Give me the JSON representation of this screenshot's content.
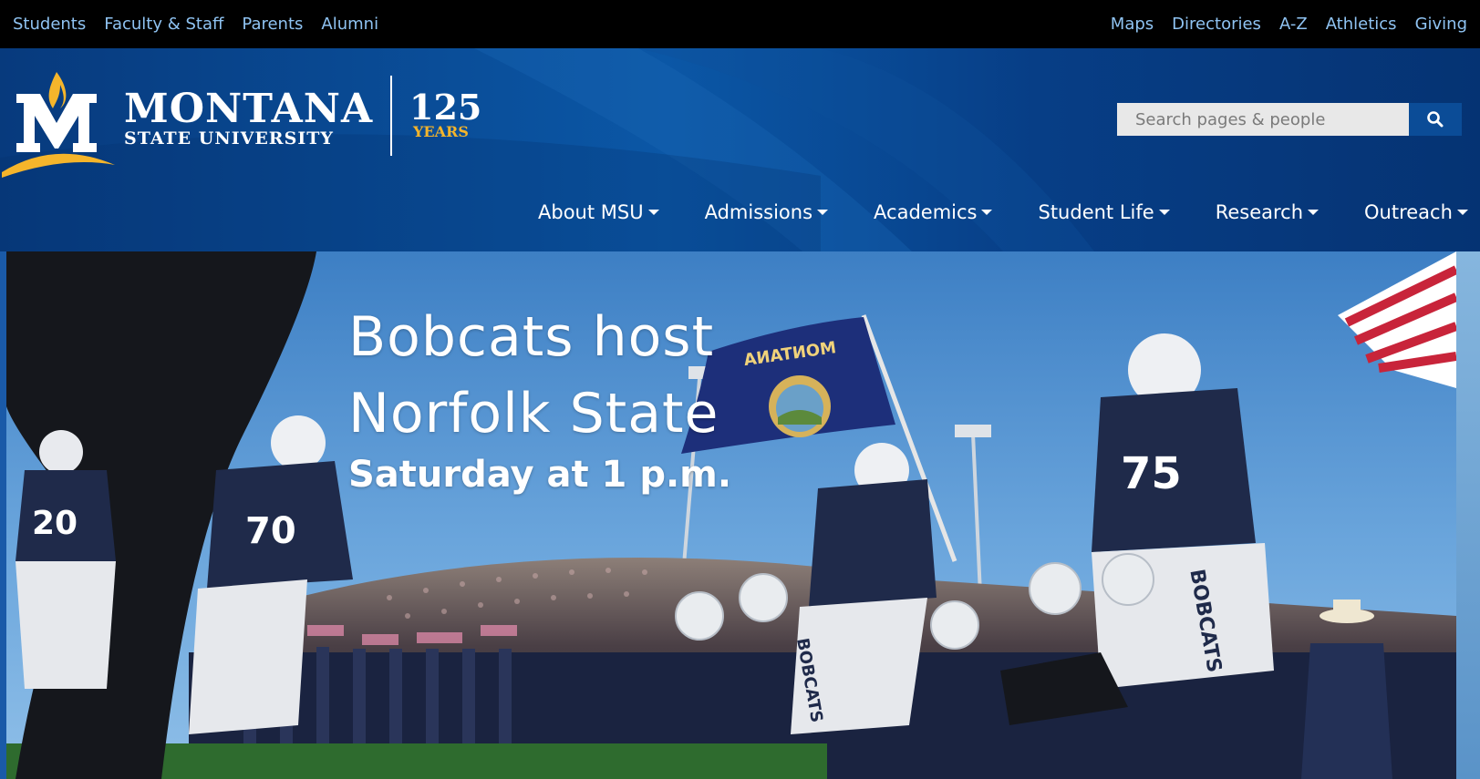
{
  "utility_nav": {
    "left": [
      {
        "label": "Students"
      },
      {
        "label": "Faculty & Staff"
      },
      {
        "label": "Parents"
      },
      {
        "label": "Alumni"
      }
    ],
    "right": [
      {
        "label": "Maps"
      },
      {
        "label": "Directories"
      },
      {
        "label": "A-Z"
      },
      {
        "label": "Athletics"
      },
      {
        "label": "Giving"
      }
    ]
  },
  "logo": {
    "wordmark_line1": "MONTANA",
    "wordmark_line2": "STATE UNIVERSITY",
    "anniversary_number": "125",
    "anniversary_word": "YEARS"
  },
  "search": {
    "placeholder": "Search pages & people",
    "icon": "search-icon"
  },
  "main_nav": [
    {
      "label": "About MSU"
    },
    {
      "label": "Admissions"
    },
    {
      "label": "Academics"
    },
    {
      "label": "Student Life"
    },
    {
      "label": "Research"
    },
    {
      "label": "Outreach"
    }
  ],
  "hero": {
    "headline_line1": "Bobcats host",
    "headline_line2": "Norfolk State",
    "subline": "Saturday at 1 p.m.",
    "flag_text": "MONTANA",
    "jersey_text": "BOBCATS"
  },
  "colors": {
    "utility_bg": "#000000",
    "utility_link": "#8fc3f2",
    "header_bg": "#063b80",
    "search_button": "#0b4c97",
    "gold": "#f5b52b"
  }
}
